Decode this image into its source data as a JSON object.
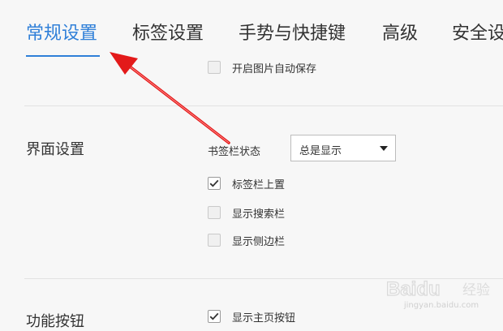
{
  "tabs": [
    {
      "label": "常规设置",
      "active": true
    },
    {
      "label": "标签设置"
    },
    {
      "label": "手势与快捷键"
    },
    {
      "label": "高级"
    },
    {
      "label": "安全设"
    }
  ],
  "top_option": {
    "label": "开启图片自动保存",
    "checked": false
  },
  "interface": {
    "title": "界面设置",
    "bookmark_bar_label": "书签栏状态",
    "bookmark_bar_value": "总是显示",
    "options": [
      {
        "label": "标签栏上置",
        "checked": true
      },
      {
        "label": "显示搜索栏",
        "checked": false
      },
      {
        "label": "显示侧边栏",
        "checked": false
      }
    ]
  },
  "function_buttons": {
    "title": "功能按钮",
    "options": [
      {
        "label": "显示主页按钮",
        "checked": true
      }
    ]
  },
  "watermark": {
    "brand": "Baidu",
    "suffix": "经验",
    "url": "jingyan.baidu.com"
  },
  "colors": {
    "accent": "#2f7fd8",
    "annotation_arrow": "#e31a1a"
  }
}
